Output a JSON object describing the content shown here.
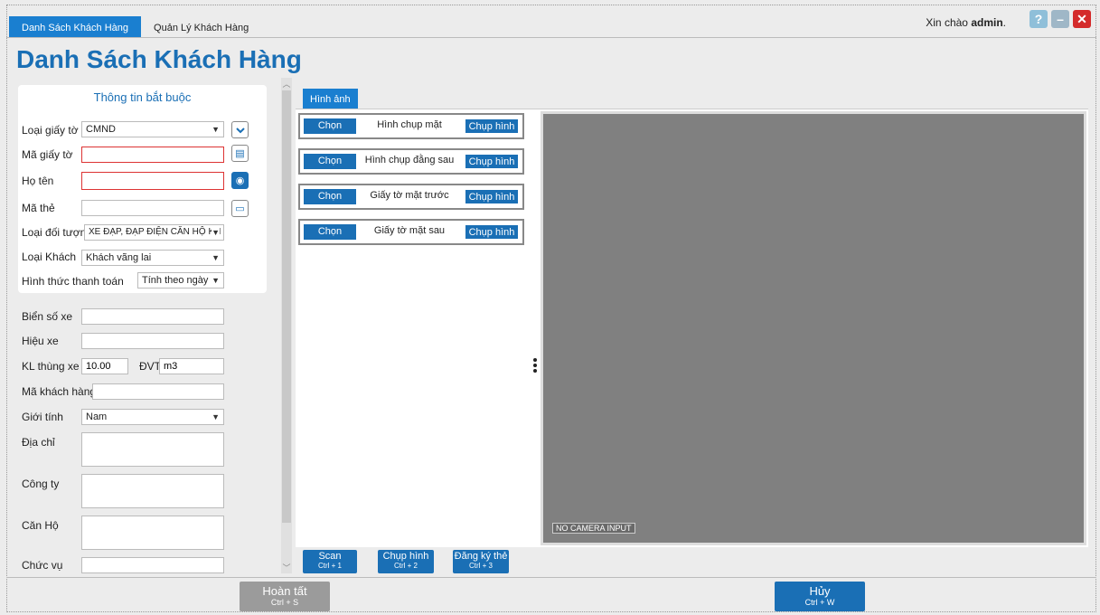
{
  "tabs": [
    {
      "label": "Danh Sách Khách Hàng",
      "active": true
    },
    {
      "label": "Quản Lý Khách Hàng",
      "active": false
    }
  ],
  "header": {
    "greeting_prefix": "Xin chào",
    "user": "admin",
    "greeting_suffix": "."
  },
  "page_title": "Danh Sách Khách Hàng",
  "required_section": {
    "title": "Thông tin bắt buộc",
    "loai_giay_to": {
      "label": "Loại giấy tờ",
      "value": "CMND"
    },
    "ma_giay_to": {
      "label": "Mã giấy tờ",
      "value": ""
    },
    "ho_ten": {
      "label": "Họ tên",
      "value": ""
    },
    "ma_the": {
      "label": "Mã thẻ",
      "value": ""
    },
    "loai_doi_tuong": {
      "label": "Loại đối tượng",
      "value": "XE ĐẠP, ĐẠP ĐIỆN CĂN HỘ KH"
    },
    "loai_khach": {
      "label": "Loại Khách",
      "value": "Khách vãng lai"
    },
    "hinh_thuc": {
      "label": "Hình thức thanh toán",
      "value": "Tính theo ngày"
    }
  },
  "optional": {
    "bien_so": {
      "label": "Biển số xe",
      "value": ""
    },
    "hieu_xe": {
      "label": "Hiệu xe",
      "value": ""
    },
    "kl_thung": {
      "label": "KL thùng xe",
      "value": "10.00"
    },
    "dvt": {
      "label": "ĐVT",
      "value": "m3"
    },
    "ma_kh": {
      "label": "Mã khách hàng",
      "value": ""
    },
    "gioi_tinh": {
      "label": "Giới tính",
      "value": "Nam"
    },
    "dia_chi": {
      "label": "Địa chỉ",
      "value": ""
    },
    "cong_ty": {
      "label": "Công ty",
      "value": ""
    },
    "can_ho": {
      "label": "Căn Hộ",
      "value": ""
    },
    "chuc_vu": {
      "label": "Chức vụ",
      "value": ""
    }
  },
  "image_tab": "Hình ảnh",
  "captures": [
    {
      "choose": "Chọn",
      "label": "Hình chụp mặt",
      "shoot": "Chụp hình"
    },
    {
      "choose": "Chọn",
      "label": "Hình chụp đằng sau",
      "shoot": "Chụp hình"
    },
    {
      "choose": "Chọn",
      "label": "Giấy tờ mặt trước",
      "shoot": "Chụp hình"
    },
    {
      "choose": "Chọn",
      "label": "Giấy tờ mặt sau",
      "shoot": "Chụp hình"
    }
  ],
  "camera_status": "NO CAMERA INPUT",
  "actions": [
    {
      "label": "Scan",
      "shortcut": "Ctrl + 1"
    },
    {
      "label": "Chụp hình",
      "shortcut": "Ctrl + 2"
    },
    {
      "label": "Đăng ký thẻ",
      "shortcut": "Ctrl + 3"
    }
  ],
  "footer": {
    "finish": {
      "label": "Hoàn tất",
      "shortcut": "Ctrl + S"
    },
    "cancel": {
      "label": "Hủy",
      "shortcut": "Ctrl + W"
    }
  },
  "colors": {
    "accent": "#1a6fb5",
    "tab_active": "#1a7fd0",
    "disabled": "#9b9b9b",
    "close": "#d42b2b"
  }
}
